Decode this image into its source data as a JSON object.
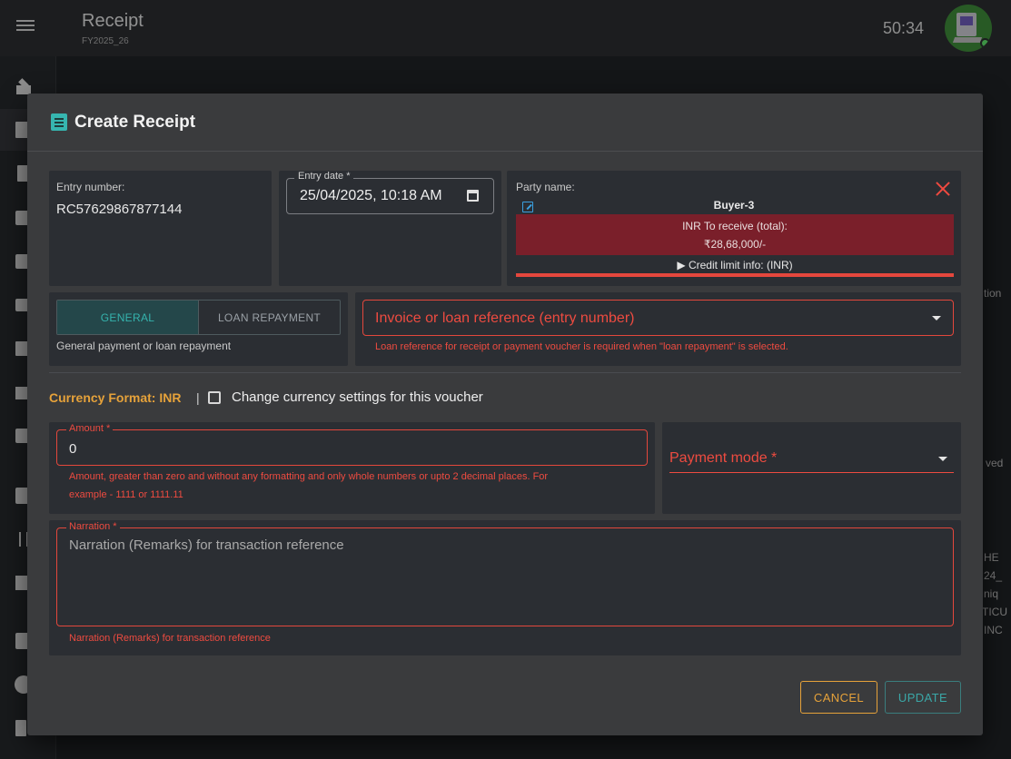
{
  "app": {
    "title": "Receipt",
    "subtitle": "FY2025_26",
    "timer": "50:34"
  },
  "background": {
    "fragments": [
      "tion",
      "ved",
      "HE",
      "24_",
      "niq",
      "TICU",
      "INC"
    ]
  },
  "dialog": {
    "title": "Create Receipt",
    "entry_number": {
      "label": "Entry number:",
      "value": "RC57629867877144"
    },
    "entry_date": {
      "label": "Entry date *",
      "value": "25/04/2025, 10:18 AM"
    },
    "party": {
      "label": "Party name:",
      "name": "Buyer-3",
      "receive_label": "INR To receive (total):",
      "receive_value": "₹28,68,000/-",
      "credit_info": "▶ Credit limit info: (INR)"
    },
    "payment_type": {
      "options": [
        "GENERAL",
        "LOAN REPAYMENT"
      ],
      "selected": "GENERAL",
      "helper": "General payment or loan repayment"
    },
    "reference": {
      "placeholder": "Invoice or loan reference (entry number)",
      "error": "Loan reference for receipt or payment voucher is required when \"loan repayment\" is selected."
    },
    "currency": {
      "format_label": "Currency Format: INR",
      "separator": "|",
      "checkbox_label": "Change currency settings for this voucher",
      "checked": false
    },
    "amount": {
      "label": "Amount *",
      "value": "0",
      "error_line1": "Amount, greater than zero and without any formatting and only whole numbers or upto 2 decimal places. For",
      "error_line2": "example - 1111 or 1111.11"
    },
    "payment_mode": {
      "label": "Payment mode *"
    },
    "narration": {
      "label": "Narration *",
      "placeholder": "Narration (Remarks) for transaction reference",
      "helper": "Narration (Remarks) for transaction reference"
    },
    "buttons": {
      "cancel": "CANCEL",
      "update": "UPDATE"
    }
  },
  "colors": {
    "accent_teal": "#35b3ad",
    "error_red": "#ee4b40",
    "warning_orange": "#e6a23a",
    "receive_bg": "#7a1f2a"
  }
}
